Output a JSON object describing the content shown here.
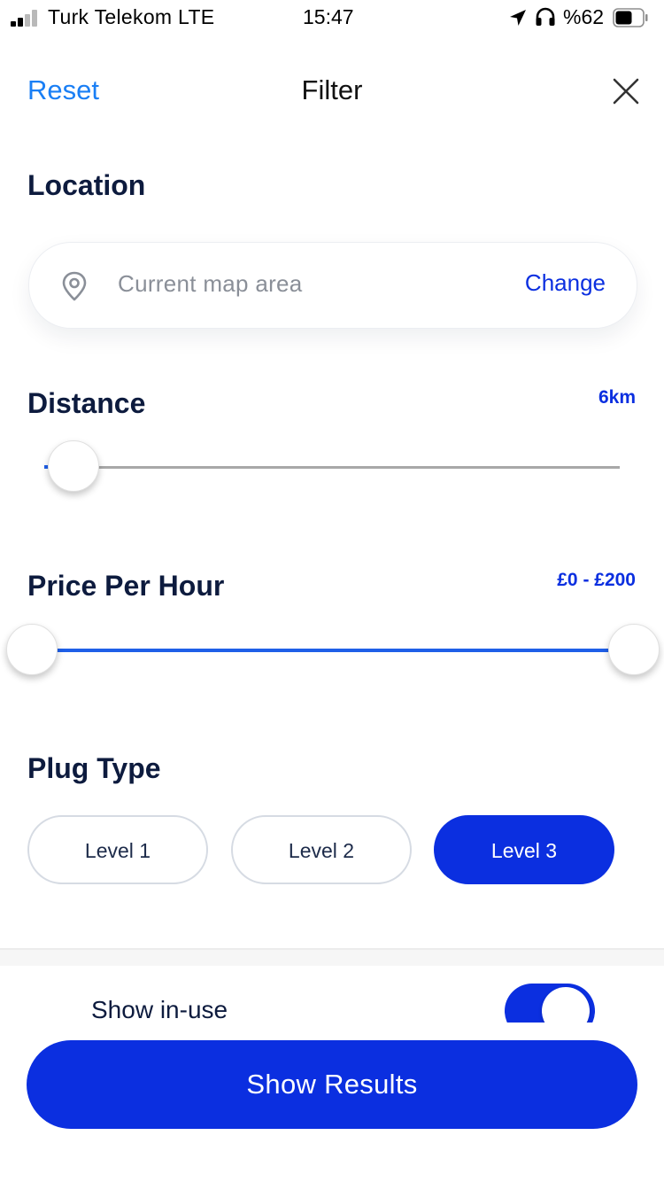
{
  "status_bar": {
    "carrier": "Turk Telekom  LTE",
    "time": "15:47",
    "battery_percent": "%62",
    "signal_bars_active": 2,
    "signal_bars_total": 4,
    "battery_level": 0.62,
    "icons": [
      "signal-icon",
      "location-arrow-icon",
      "headphones-icon",
      "battery-icon"
    ]
  },
  "header": {
    "reset_label": "Reset",
    "title": "Filter",
    "close_icon": "close-icon"
  },
  "location": {
    "heading": "Location",
    "placeholder": "Current map area",
    "change_label": "Change",
    "icon": "map-pin-icon"
  },
  "distance": {
    "heading": "Distance",
    "value_label": "6km",
    "value": 6
  },
  "price": {
    "heading": "Price Per Hour",
    "value_label": "£0 - £200",
    "min": 0,
    "max": 200
  },
  "plug_type": {
    "heading": "Plug Type",
    "options": [
      {
        "label": "Level 1",
        "selected": false
      },
      {
        "label": "Level 2",
        "selected": false
      },
      {
        "label": "Level 3",
        "selected": true
      }
    ]
  },
  "footer": {
    "show_in_use_label": "Show in-use",
    "show_in_use_on": true,
    "show_results_label": "Show Results"
  },
  "colors": {
    "accent_blue": "#0b2fe0",
    "link_blue": "#1a7ff5",
    "slider_blue": "#1f5fe8",
    "heading_navy": "#0d1b3e"
  }
}
